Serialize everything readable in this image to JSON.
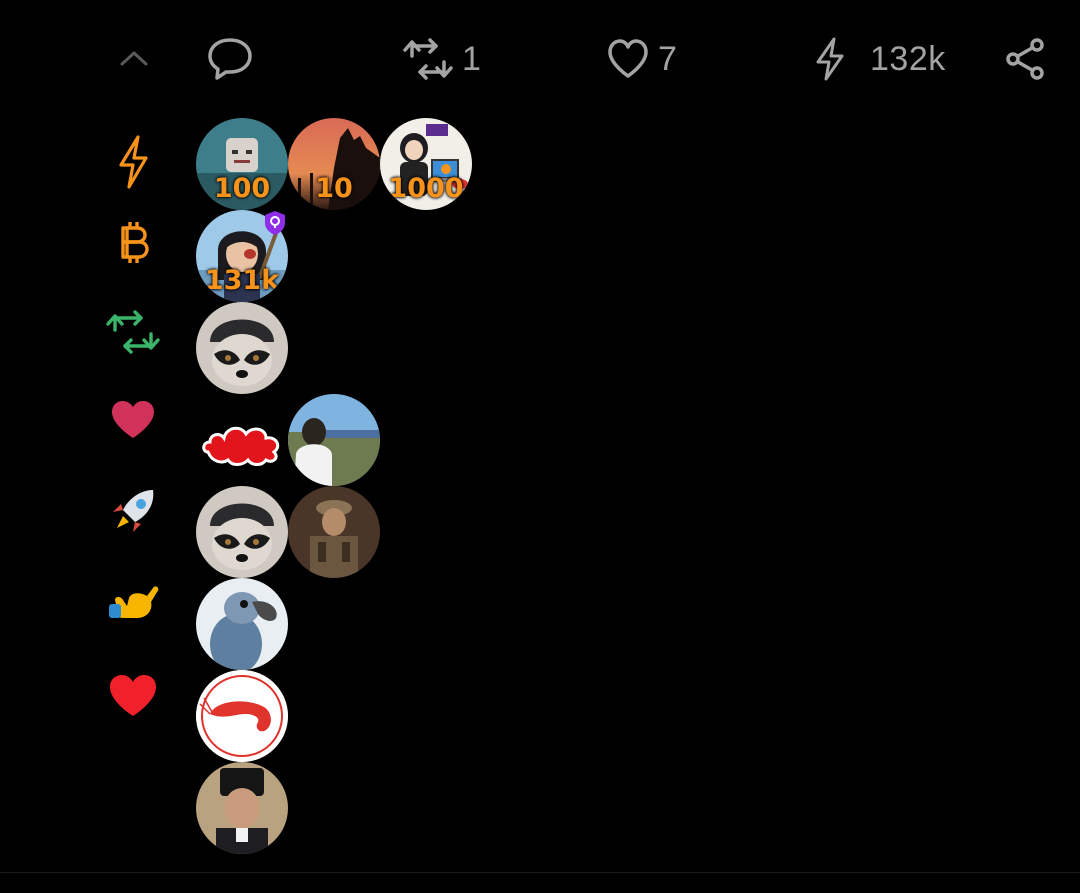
{
  "header_fragment": "",
  "actions": {
    "collapse": {
      "icon": "chevron-up-icon"
    },
    "reply": {
      "icon": "comment-icon"
    },
    "repost": {
      "icon": "repost-icon",
      "count": "1"
    },
    "like": {
      "icon": "heart-outline-icon",
      "count": "7"
    },
    "zap": {
      "icon": "lightning-icon",
      "count": "132k"
    },
    "share": {
      "icon": "share-icon"
    }
  },
  "reactions": [
    {
      "icon": "lightning-icon",
      "color": "#f7931a",
      "avatars": [
        {
          "amount": "100",
          "name": "avatar-robot"
        },
        {
          "amount": "10",
          "name": "avatar-sunset"
        },
        {
          "amount": "1000",
          "name": "avatar-anime-laptop"
        }
      ]
    },
    {
      "icon": "bitcoin-icon",
      "color": "#f7931a",
      "avatars": [
        {
          "amount": "131k",
          "name": "avatar-anime-warrior"
        }
      ]
    },
    {
      "icon": "repost-icon",
      "color": "#3bb56c",
      "avatars": [
        {
          "amount": "",
          "name": "avatar-raccoon"
        }
      ]
    },
    {
      "icon": "heart-emoji-icon",
      "color": "#d0325a",
      "avatars": [
        {
          "amount": "",
          "name": "avatar-red-cloud"
        },
        {
          "amount": "",
          "name": "avatar-hiker"
        }
      ]
    },
    {
      "icon": "rocket-emoji-icon",
      "color": "#d94a3a",
      "avatars": [
        {
          "amount": "",
          "name": "avatar-raccoon"
        },
        {
          "amount": "",
          "name": "avatar-soldier"
        }
      ]
    },
    {
      "icon": "call-me-hand-emoji-icon",
      "color": "#f7b500",
      "avatars": [
        {
          "amount": "",
          "name": "avatar-dodo"
        }
      ]
    },
    {
      "icon": "red-heart-emoji-icon",
      "color": "#f0212a",
      "avatars": [
        {
          "amount": "",
          "name": "avatar-shrimp"
        },
        {
          "amount": "",
          "name": "avatar-man-hat"
        }
      ]
    }
  ]
}
